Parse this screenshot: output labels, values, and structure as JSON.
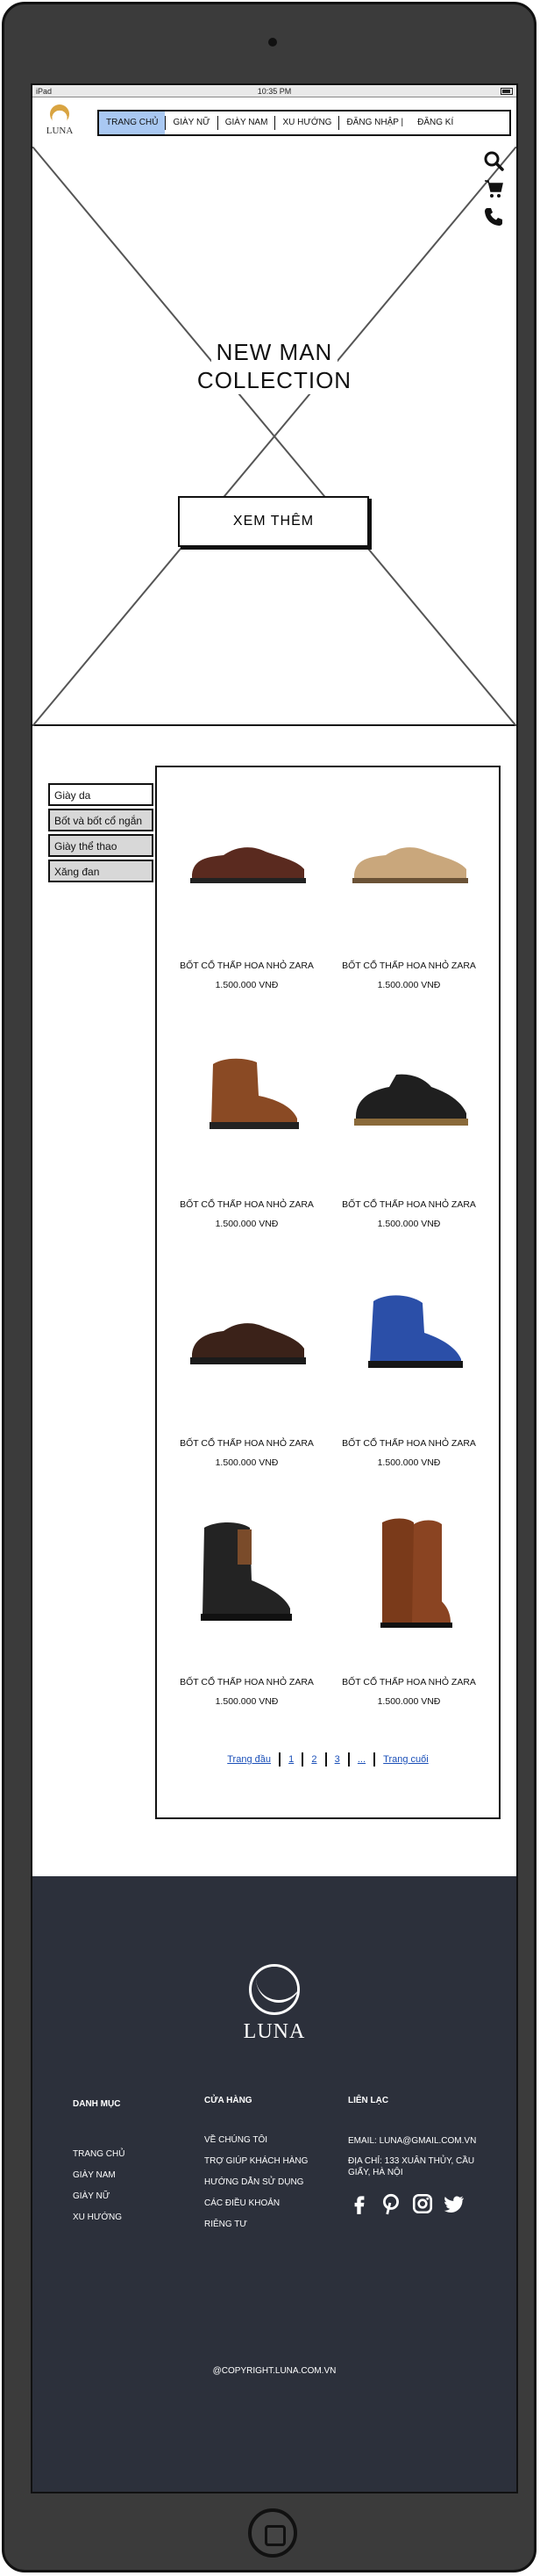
{
  "status_bar": {
    "device": "iPad",
    "time": "10:35 PM"
  },
  "header": {
    "logo_text": "LUNA",
    "nav": [
      {
        "label": "TRANG CHỦ",
        "active": true
      },
      {
        "label": "GIÀY NỮ"
      },
      {
        "label": "GIÀY NAM"
      },
      {
        "label": "XU HƯỚNG"
      },
      {
        "label": "ĐĂNG NHẬP"
      },
      {
        "label": "ĐĂNG KÍ"
      }
    ],
    "nav_divider": "|",
    "icons": [
      "search-icon",
      "cart-icon",
      "phone-icon"
    ]
  },
  "hero": {
    "title_line1": "NEW MAN",
    "title_line2": "COLLECTION",
    "button_label": "XEM THÊM"
  },
  "categories": [
    "Giày da",
    "Bốt và bốt cổ ngắn",
    "Giày thể thao",
    "Xăng đan"
  ],
  "products": [
    {
      "name": "BỐT CỔ THẤP HOA NHỎ ZARA",
      "price": "1.500.000 VNĐ",
      "color": "#5a2a1f"
    },
    {
      "name": "BỐT CỔ THẤP HOA NHỎ ZARA",
      "price": "1.500.000 VNĐ",
      "color": "#c9a77c"
    },
    {
      "name": "BỐT CỔ THẤP HOA NHỎ ZARA",
      "price": "1.500.000 VNĐ",
      "color": "#8a4a24"
    },
    {
      "name": "BỐT CỔ THẤP HOA NHỎ ZARA",
      "price": "1.500.000 VNĐ",
      "color": "#1f1f1f"
    },
    {
      "name": "BỐT CỔ THẤP HOA NHỎ ZARA",
      "price": "1.500.000 VNĐ",
      "color": "#3b2219"
    },
    {
      "name": "BỐT CỔ THẤP HOA NHỎ ZARA",
      "price": "1.500.000 VNĐ",
      "color": "#2b4fa8"
    },
    {
      "name": "BỐT CỔ THẤP HOA NHỎ ZARA",
      "price": "1.500.000 VNĐ",
      "color": "#232323"
    },
    {
      "name": "BỐT CỔ THẤP HOA NHỎ ZARA",
      "price": "1.500.000 VNĐ",
      "color": "#7a3a1a"
    }
  ],
  "pagination": {
    "first": "Trang đầu",
    "pages": [
      "1",
      "2",
      "3"
    ],
    "ellipsis": "...",
    "last": "Trang cuối"
  },
  "footer": {
    "brand": "LUNA",
    "col1": {
      "title": "DANH MỤC",
      "items": [
        "TRANG CHỦ",
        "GIÀY NAM",
        "GIÀY NỮ",
        "XU HƯỚNG"
      ]
    },
    "col2": {
      "title": "CỬA HÀNG",
      "items": [
        "VỀ CHÚNG TÔI",
        "TRỢ GIÚP KHÁCH HÀNG",
        "HƯỚNG DẪN SỬ DỤNG",
        "CÁC ĐIỀU KHOẢN",
        "RIÊNG TƯ"
      ]
    },
    "col3": {
      "title": "LIÊN LẠC",
      "email": "EMAIL: LUNA@GMAIL.COM.VN",
      "address": "ĐỊA CHỈ: 133 XUÂN THỦY, CẦU GIẤY, HÀ NỘI"
    },
    "socials": [
      "facebook-icon",
      "pinterest-icon",
      "instagram-icon",
      "twitter-icon"
    ],
    "copyright": "@COPYRIGHT.LUNA.COM.VN"
  },
  "colors": {
    "nav_active": "#a9c8f2",
    "footer_bg": "#2c303b",
    "link": "#1a4fb8"
  }
}
